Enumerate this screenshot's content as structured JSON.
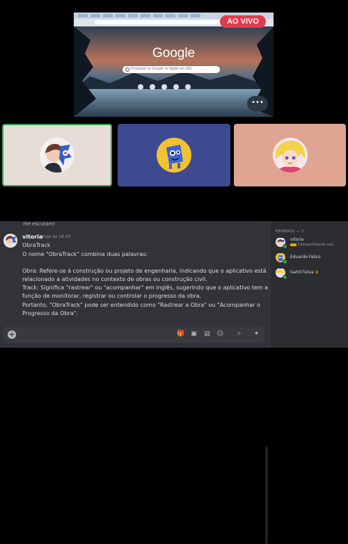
{
  "stream": {
    "live_label": "AO VIVO",
    "google_logo": "Google",
    "search_placeholder": "Pesquisar no Google ou digitar um URL",
    "more_button": "•••"
  },
  "participants": [
    {
      "name": "participant-1",
      "border": "#3ba55c"
    },
    {
      "name": "participant-2"
    },
    {
      "name": "participant-3"
    }
  ],
  "chat": {
    "topline": "me escutam!",
    "author": "vitoria",
    "time": "Hoje às 18:43",
    "lines": [
      "ObraTrack",
      "O nome \"ObraTrack\" combina duas palavras:",
      "Obra: Refere-se à construção ou projeto de engenharia, indicando que o aplicativo está",
      "relacionado a atividades no contexto de obras ou construção civil.",
      "Track: Significa \"rastrear\" ou \"acompanhar\" em inglês, sugerindo que o aplicativo tem a",
      "função de monitorar, registrar ou controlar o progresso da obra.",
      "Portanto, \"ObraTrack\" pode ser entendido como \"Rastrear a Obra\" ou \"Acompanhar o",
      "Progresso da Obra\"."
    ]
  },
  "members": {
    "header": "MEMBROS — 3",
    "list": [
      {
        "name": "vitoria",
        "status": "Compartilhando tela"
      },
      {
        "name": "Eduardo Falico",
        "status": ""
      },
      {
        "name": "Isah07silva",
        "status": ""
      }
    ]
  },
  "colors": {
    "accent_green": "#23a55a",
    "live_red": "#e33b4e",
    "chat_bg": "#313338",
    "members_bg": "#2b2d31"
  }
}
